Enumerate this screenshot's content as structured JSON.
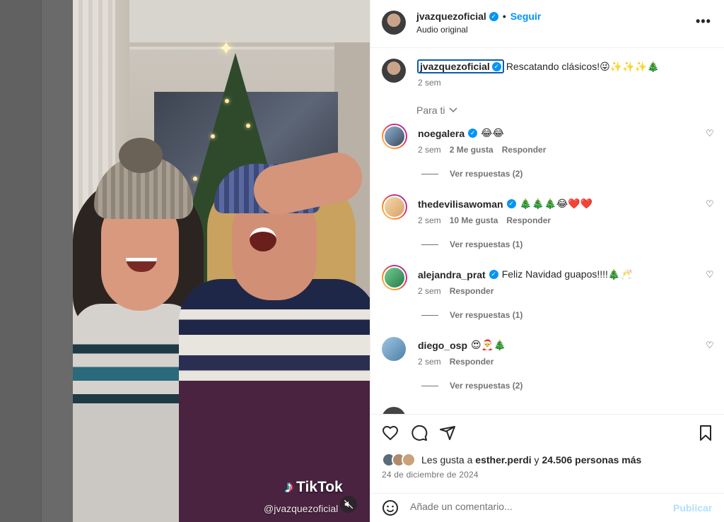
{
  "header": {
    "username": "jvazquezoficial",
    "follow_label": "Seguir",
    "dot": "•",
    "subtitle": "Audio original",
    "more": "•••"
  },
  "caption": {
    "username": "jvazquezoficial",
    "text": "Rescatando clásicos!😜✨✨✨🎄",
    "time": "2 sem"
  },
  "filter": {
    "label": "Para ti"
  },
  "comments": [
    {
      "username": "noegalera",
      "verified": true,
      "text": "😂😂",
      "time": "2 sem",
      "likes": "2 Me gusta",
      "reply": "Responder",
      "replies": "Ver respuestas (2)"
    },
    {
      "username": "thedevilisawoman",
      "verified": true,
      "text": "🎄🎄🎄😂❤️❤️",
      "time": "2 sem",
      "likes": "10 Me gusta",
      "reply": "Responder",
      "replies": "Ver respuestas (1)"
    },
    {
      "username": "alejandra_prat",
      "verified": true,
      "text": "Feliz Navidad guapos!!!!🎄🥂",
      "time": "2 sem",
      "likes": "",
      "reply": "Responder",
      "replies": "Ver respuestas (1)"
    },
    {
      "username": "diego_osp",
      "verified": false,
      "text": "😍🎅🎄",
      "time": "2 sem",
      "likes": "",
      "reply": "Responder",
      "replies": "Ver respuestas (2)"
    }
  ],
  "actions": {
    "likes_prefix": "Les gusta a",
    "likes_user": "esther.perdi",
    "likes_conj": "y",
    "likes_rest": "24.506 personas más",
    "date": "24 de diciembre de 2024"
  },
  "add_comment": {
    "placeholder": "Añade un comentario...",
    "publish": "Publicar"
  },
  "video": {
    "watermark": "TikTok",
    "handle": "@jvazquezoficial"
  },
  "colors": {
    "accent": "#0095f6",
    "text": "#262626",
    "muted": "#737373",
    "publish_disabled": "#b2dffc"
  }
}
